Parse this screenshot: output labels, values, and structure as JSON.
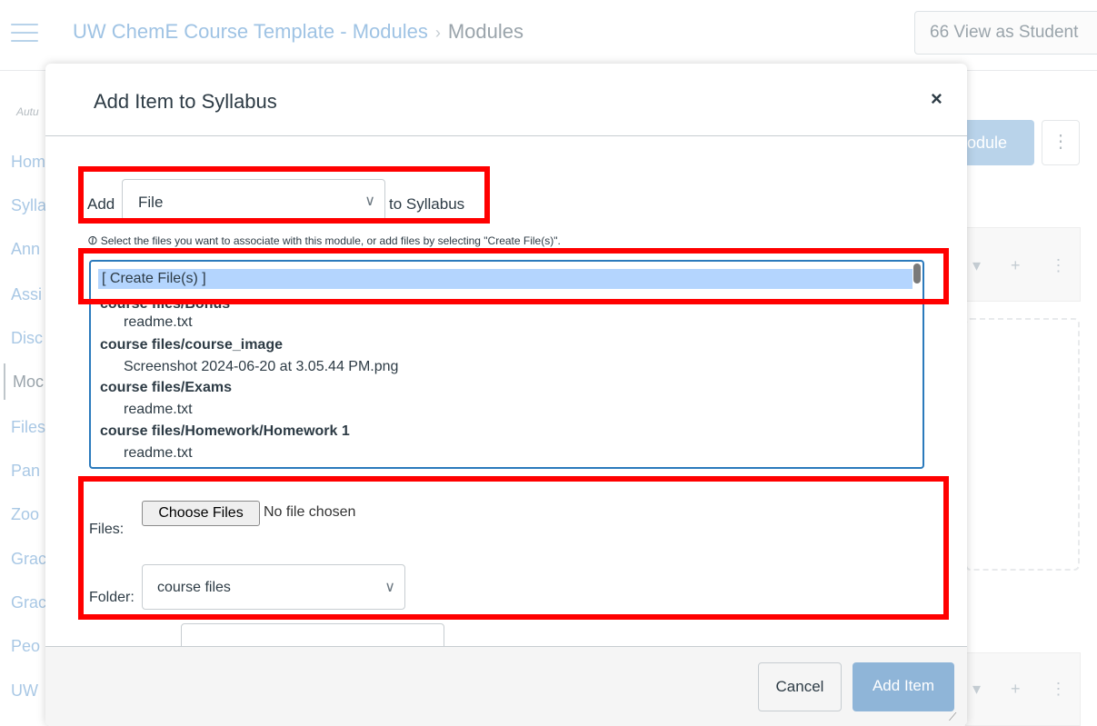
{
  "background": {
    "breadcrumb": {
      "course": "UW ChemE Course Template - Modules",
      "separator": "›",
      "current": "Modules"
    },
    "view_as_student": "View as Student",
    "view_as_student_icon": "glasses-icon",
    "sidebar": {
      "term": "Autu",
      "items": [
        "Hom",
        "Sylla",
        "Ann",
        "Assi",
        "Disc",
        "Moc",
        "Files",
        "Pan",
        "Zoo",
        "Grac",
        "Grac",
        "Peo",
        "UW"
      ]
    },
    "module_button": "odule",
    "kebab": "⋮",
    "row_controls": "▾ + ⋮"
  },
  "modal": {
    "title": "Add Item to Syllabus",
    "close": "×",
    "add_label": "Add",
    "item_type": "File",
    "to_label": "to Syllabus",
    "hint": "Select the files you want to associate with this module, or add files by selecting \"Create File(s)\".",
    "file_list": [
      {
        "text": "[ Create File(s) ]",
        "kind": "selected"
      },
      {
        "text": "course files/Bonus",
        "kind": "folder"
      },
      {
        "text": "readme.txt",
        "kind": "file"
      },
      {
        "text": "course files/course_image",
        "kind": "folder"
      },
      {
        "text": "Screenshot 2024-06-20 at 3.05.44 PM.png",
        "kind": "file"
      },
      {
        "text": "course files/Exams",
        "kind": "folder"
      },
      {
        "text": "readme.txt",
        "kind": "file"
      },
      {
        "text": "course files/Homework/Homework 1",
        "kind": "folder"
      },
      {
        "text": "readme.txt",
        "kind": "file"
      }
    ],
    "files_label": "Files:",
    "choose_files": "Choose Files",
    "no_file": "No file chosen",
    "folder_label": "Folder:",
    "folder_value": "course files",
    "cancel": "Cancel",
    "add_item": "Add Item"
  },
  "colors": {
    "highlight": "#ff0000",
    "primary": "#2b7abc",
    "selected_bg": "#b4d5fe"
  }
}
